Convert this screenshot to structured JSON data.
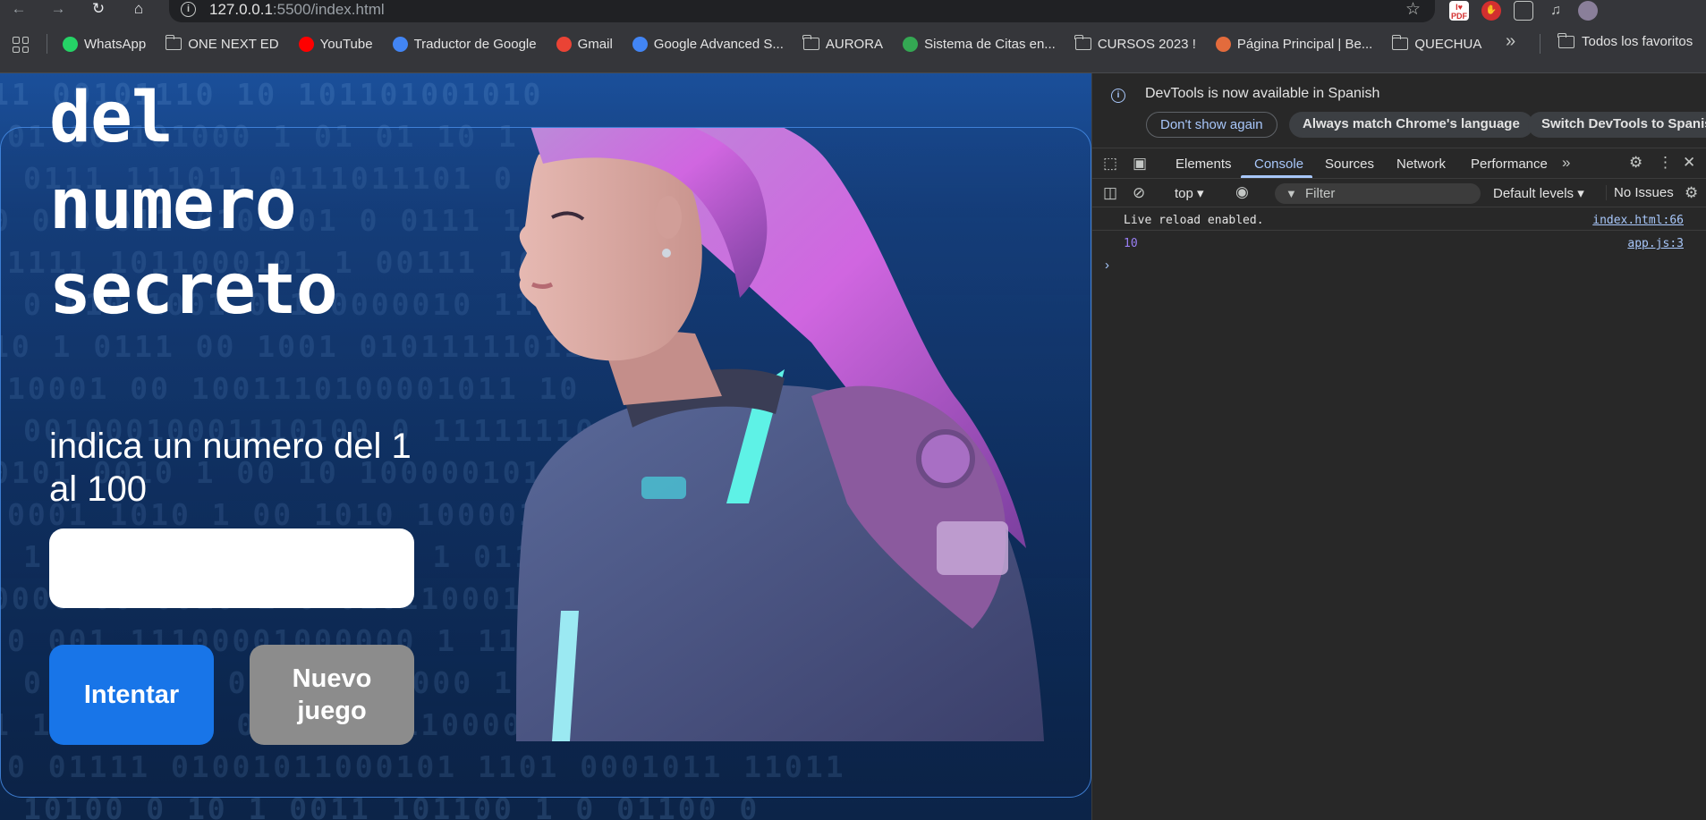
{
  "browser": {
    "url_host": "127.0.0.1",
    "url_rest": ":5500/index.html",
    "bookmarks": [
      {
        "label": "WhatsApp",
        "icon": "whatsapp-icon",
        "color": "#25d366"
      },
      {
        "label": "ONE NEXT ED",
        "icon": "folder-icon"
      },
      {
        "label": "YouTube",
        "icon": "youtube-icon",
        "color": "#ff0000"
      },
      {
        "label": "Traductor de Google",
        "icon": "google-translate-icon",
        "color": "#4285f4"
      },
      {
        "label": "Gmail",
        "icon": "gmail-icon",
        "color": "#ea4335"
      },
      {
        "label": "Google Advanced S...",
        "icon": "google-icon",
        "color": "#4285f4"
      },
      {
        "label": "AURORA",
        "icon": "folder-icon"
      },
      {
        "label": "Sistema de Citas en...",
        "icon": "sistema-icon",
        "color": "#34a853"
      },
      {
        "label": "CURSOS 2023 !",
        "icon": "folder-icon"
      },
      {
        "label": "Página Principal | Be...",
        "icon": "page-icon",
        "color": "#e36b3c"
      },
      {
        "label": "QUECHUA",
        "icon": "folder-icon"
      }
    ],
    "all_bookmarks": "Todos los favoritos"
  },
  "page": {
    "title_lines": [
      "del",
      "numero",
      "secreto"
    ],
    "instruction": "indica un numero del 1 al 100",
    "input_value": "",
    "btn_try": "Intentar",
    "btn_new": "Nuevo juego",
    "binary_rows": [
      "11 00101110 10 101101001010",
      "01 00 101000 1 01 01 10 1",
      "0111 111011 0111011101 0 1 0",
      "0 0 01011 0101101 0 0111 1 0 1",
      "1111 1011000101 1 00111 10110 1",
      "0 010 1001 0 1 0000010 11 0 1 01",
      "10 1 0111 00 1001 01011111011",
      "10001 00 1001110100001011 10",
      "00100010001110100 0 11111110 1 00",
      "0101 0010 1 00 10 10000010101",
      "0001 1010 1 00 1010 100001101000",
      "1 00 10 001100 0101 1 01110 0",
      "0000 00 0010 1 0 01011000110 0",
      "0 001 11100001000000 1 11 101111",
      "0 011 1 0 001 0011 000 1 0 00110",
      "1 1 110 1 1 0 1 0010110000101 00",
      "0 01111 01001011000101 1101 0001011 11011",
      "10100 0 10 1 0011 101100 1 0 01100 0"
    ],
    "colors": {
      "try": "#1875e8",
      "new": "#8c8c8c",
      "border": "#468ce6"
    }
  },
  "devtools": {
    "info_text": "DevTools is now available in Spanish",
    "btn_dont_show": "Don't show again",
    "btn_match": "Always match Chrome's language",
    "btn_switch": "Switch DevTools to Spanish",
    "tabs": [
      "Elements",
      "Console",
      "Sources",
      "Network",
      "Performance"
    ],
    "context": "top",
    "filter_placeholder": "Filter",
    "levels": "Default levels",
    "issues": "No Issues",
    "messages": [
      {
        "text": "Live reload enabled.",
        "source": "index.html:66"
      },
      {
        "text": "10",
        "source": "app.js:3"
      }
    ]
  }
}
